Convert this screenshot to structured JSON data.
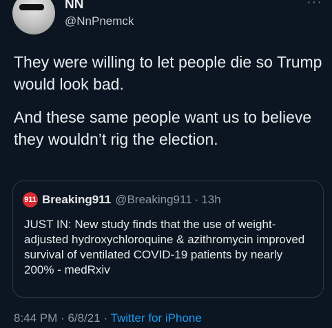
{
  "author": {
    "display_name": "NN",
    "handle": "@NnPnemck"
  },
  "tweet": {
    "paragraph1": "They were willing to let people die so Trump would look bad.",
    "paragraph2": "And these same people want us to believe they wouldn’t rig the election."
  },
  "quoted": {
    "logo_text": "911",
    "name": "Breaking911",
    "handle": "@Breaking911",
    "separator": "·",
    "time": "13h",
    "text": "JUST IN: New study finds that the use of weight-adjusted hydroxychloroquine & azithromycin improved survival of ventilated COVID-19 patients by nearly 200% - medRxiv"
  },
  "footer": {
    "time": "8:44 PM",
    "dot1": "·",
    "date": "6/8/21",
    "dot2": "·",
    "source": "Twitter for iPhone"
  },
  "icons": {
    "more": "more-icon"
  },
  "colors": {
    "background": "#0b1622",
    "link": "#1d9bf0",
    "brand_badge": "#d92b33"
  }
}
